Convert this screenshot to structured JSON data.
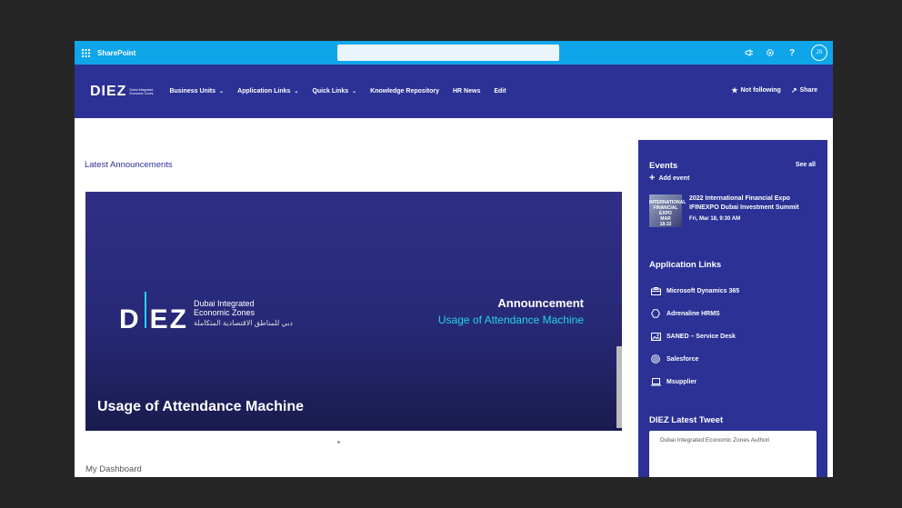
{
  "suite_bar": {
    "app_name": "SharePoint",
    "avatar_initials": "JS"
  },
  "site_header": {
    "logo_text": "DIEZ",
    "logo_subtext": "Dubai Integrated Economic Zones",
    "nav": [
      {
        "label": "Business Units",
        "has_dropdown": true
      },
      {
        "label": "Application Links",
        "has_dropdown": true
      },
      {
        "label": "Quick Links",
        "has_dropdown": true
      },
      {
        "label": "Knowledge Repository",
        "has_dropdown": false
      },
      {
        "label": "HR News",
        "has_dropdown": false
      },
      {
        "label": "Edit",
        "has_dropdown": false
      }
    ],
    "actions": {
      "follow_label": "Not following",
      "share_label": "Share"
    }
  },
  "announcements": {
    "title": "Latest Announcements",
    "hero": {
      "logo_text": "DIEZ",
      "logo_sub_line1": "Dubai Integrated",
      "logo_sub_line2": "Economic Zones",
      "logo_arabic": "دبي للمناطق الاقتصادية المتكاملة",
      "kicker": "Announcement",
      "subtitle": "Usage of Attendance Machine",
      "caption": "Usage of Attendance Machine"
    }
  },
  "dashboard": {
    "title": "My Dashboard"
  },
  "right_panel": {
    "events": {
      "title": "Events",
      "see_all": "See all",
      "add_event": "Add event",
      "items": [
        {
          "thumb_line1": "INTERNATIONAL",
          "thumb_line2": "FINANCIAL EXPO",
          "thumb_line3": "MAR",
          "thumb_line4": "18-22",
          "title": "2022 International Financial Expo IFINEXPO Dubai Investment Summit",
          "time": "Fri, Mar 18, 9:30 AM"
        }
      ]
    },
    "application_links": {
      "title": "Application Links",
      "items": [
        {
          "label": "Microsoft Dynamics 365",
          "icon": "briefcase-icon"
        },
        {
          "label": "Adrenaline HRMS",
          "icon": "hexagon-icon"
        },
        {
          "label": "SANED – Service Desk",
          "icon": "image-icon"
        },
        {
          "label": "Salesforce",
          "icon": "target-icon"
        },
        {
          "label": "Msupplier",
          "icon": "laptop-icon"
        }
      ]
    },
    "tweet": {
      "title": "DIEZ Latest Tweet",
      "account": "Dubai Integrated Economic Zones Authori"
    }
  },
  "colors": {
    "suite_bar": "#0ea5e9",
    "brand": "#2b3195",
    "accent": "#22d3ee"
  }
}
